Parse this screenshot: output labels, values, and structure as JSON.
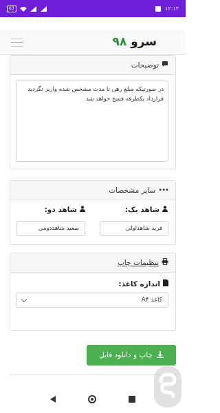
{
  "status_bar": {
    "time": "۱۲:۱۲",
    "battery": "63"
  },
  "brand": {
    "text": "سرو",
    "number": "۹۸"
  },
  "description_card": {
    "title": "توضیحات",
    "text": "در صورتیکه مبلغ رهن تا مدت مشخص شده واریز نگردید قرارداد یکطرفه فسخ خواهد شد"
  },
  "other_card": {
    "title": "سایر مشخصات",
    "witness1_label": "شاهد یک:",
    "witness1_value": "فرید شاهداولی",
    "witness2_label": "شاهد دو:",
    "witness2_value": "سعید شاهددومی"
  },
  "print_card": {
    "title": "تنظیمات چاپ",
    "paper_label": "اندازه کاغذ:",
    "paper_value": "کاغذ A۴"
  },
  "actions": {
    "print_download": "چاپ و دانلود فایل"
  },
  "icons": {
    "comment": "comment-icon",
    "dots": "dots-icon",
    "user": "user-icon",
    "printer": "printer-icon",
    "file": "file-icon",
    "download": "download-icon"
  }
}
